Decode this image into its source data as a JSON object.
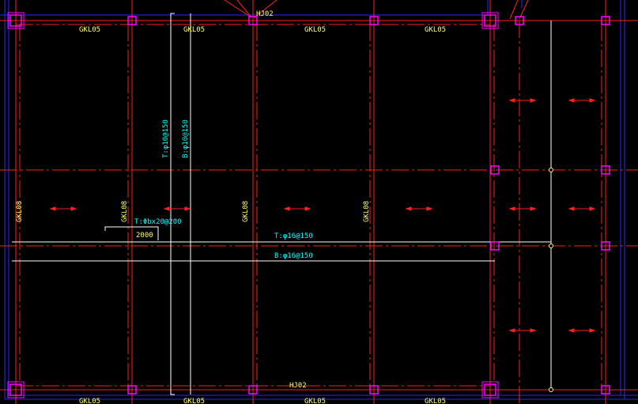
{
  "colors": {
    "background": "#000000",
    "axis": "#ff2020",
    "wall": "#2a2aff",
    "rebar": "#ffffff",
    "column": "#ff00ff",
    "beam_label": "#ffff66",
    "rebar_label": "#00ffff"
  },
  "labels": {
    "beam_top_1": "GKL05",
    "beam_top_2": "GKL05",
    "beam_top_3": "GKL05",
    "beam_top_4": "GKL05",
    "beam_bottom_1": "GKL05",
    "beam_bottom_2": "GKL05",
    "beam_bottom_3": "GKL05",
    "beam_bottom_4": "GKL05",
    "beam_v_1": "GKL08",
    "beam_v_2": "GKL08",
    "beam_v_3": "GKL08",
    "beam_v_4": "GKL08",
    "hj_top": "HJ02",
    "hj_bottom": "HJ02",
    "rebar_vert_top": "T:φ10@150",
    "rebar_vert_bottom": "B:φ10@150",
    "rebar_add": "T:Φbx20@200",
    "rebar_length": "2000",
    "rebar_horiz_top": "T:φ16@150",
    "rebar_horiz_bottom": "B:φ16@150"
  },
  "icons": {
    "column": "column-square-icon",
    "slab_span": "span-arrow-icon"
  }
}
